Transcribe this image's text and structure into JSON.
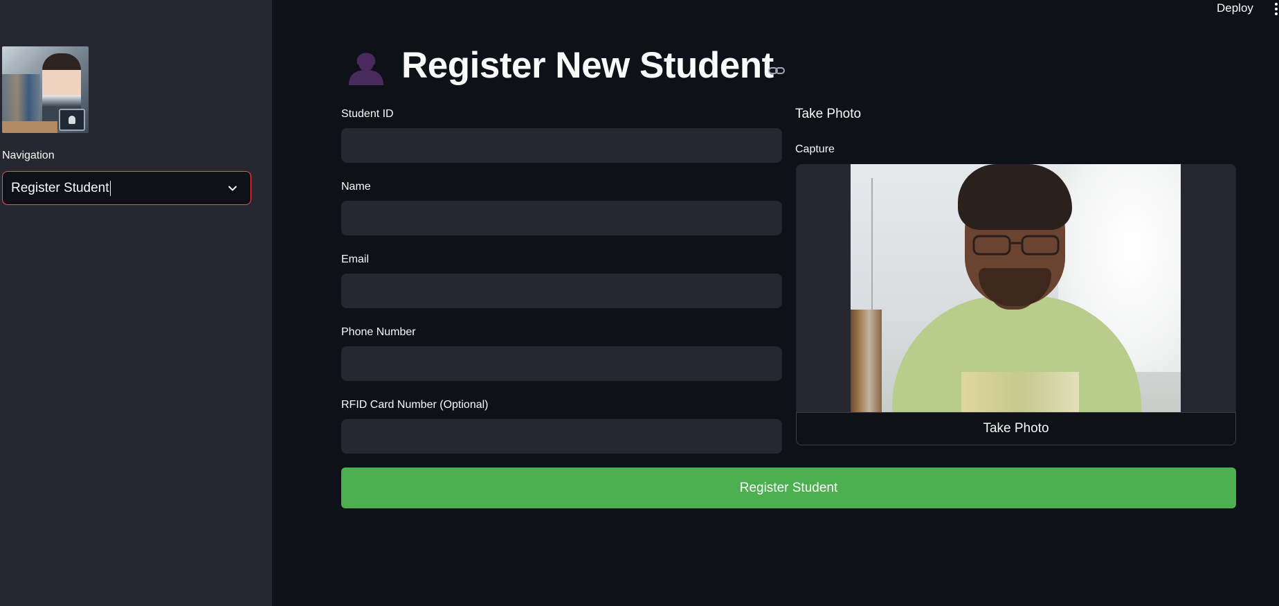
{
  "topbar": {
    "deploy_label": "Deploy",
    "menu_icon": "more-vertical-icon"
  },
  "sidebar": {
    "logo_icon": "student-id-image",
    "nav_label": "Navigation",
    "nav_selected": "Register Student"
  },
  "main": {
    "page_icon": "bust-in-silhouette-icon",
    "title": "Register New Student",
    "anchor_icon": "link-icon",
    "fields": [
      {
        "label": "Student ID",
        "value": "",
        "placeholder": ""
      },
      {
        "label": "Name",
        "value": "",
        "placeholder": ""
      },
      {
        "label": "Email",
        "value": "",
        "placeholder": ""
      },
      {
        "label": "Phone Number",
        "value": "",
        "placeholder": ""
      },
      {
        "label": "RFID Card Number (Optional)",
        "value": "",
        "placeholder": ""
      }
    ],
    "photo": {
      "heading": "Take Photo",
      "capture_label": "Capture",
      "button_label": "Take Photo"
    },
    "submit_label": "Register Student"
  },
  "colors": {
    "background": "#0e1117",
    "sidebar": "#262730",
    "input": "#262730",
    "accent_focus": "#ff4b4b",
    "submit": "#4caf50",
    "text": "#fafafa",
    "page_icon": "#4a2a5c"
  }
}
